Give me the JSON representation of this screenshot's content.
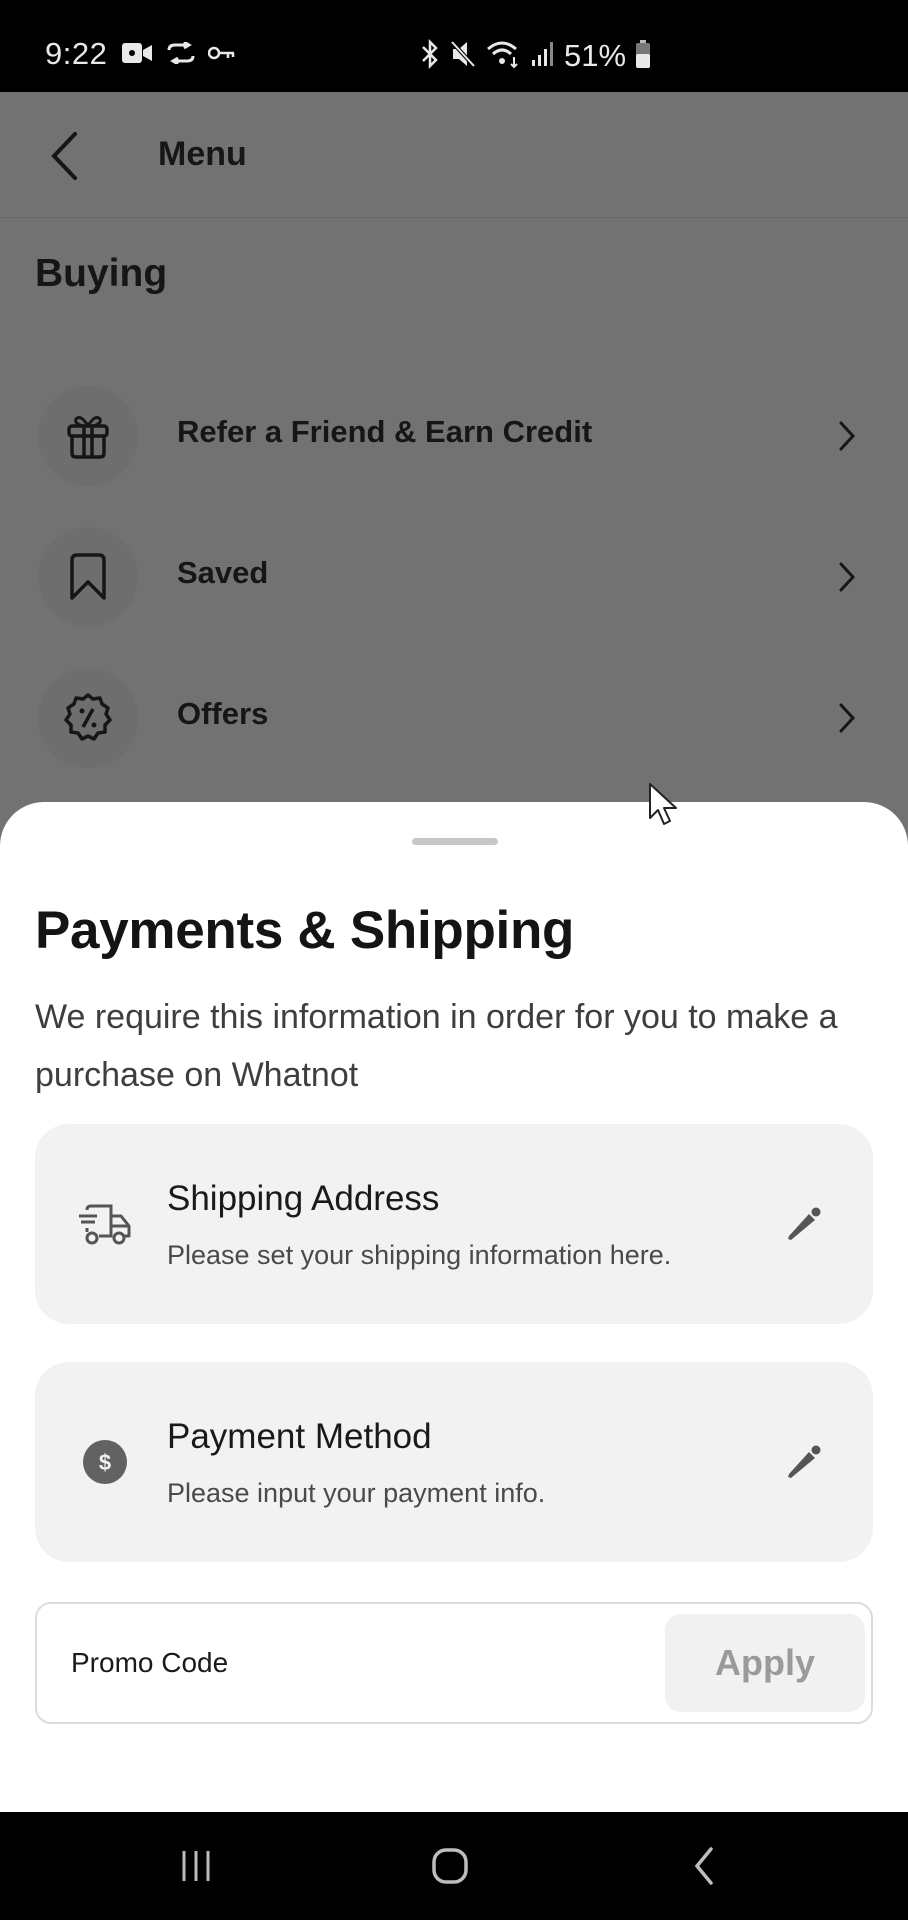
{
  "status_bar": {
    "time": "9:22",
    "battery_percent": "51%",
    "left_icons": [
      "video-record-icon",
      "sync-cloud-icon",
      "vpn-key-icon"
    ],
    "right_icons": [
      "bluetooth-icon",
      "mute-icon",
      "wifi-icon",
      "signal-icon",
      "battery-icon"
    ]
  },
  "app": {
    "header": {
      "title": "Menu",
      "back_icon": "chevron-left-icon"
    },
    "section_title": "Buying",
    "menu_items": [
      {
        "label": "Refer a Friend & Earn Credit",
        "icon": "gift-icon"
      },
      {
        "label": "Saved",
        "icon": "bookmark-icon"
      },
      {
        "label": "Offers",
        "icon": "discount-badge-icon"
      }
    ]
  },
  "sheet": {
    "title": "Payments & Shipping",
    "description": "We require this information in order for you to make a purchase on Whatnot",
    "cards": [
      {
        "title": "Shipping Address",
        "subtitle": "Please set your shipping information here.",
        "icon": "truck-icon",
        "action_icon": "pencil-icon"
      },
      {
        "title": "Payment Method",
        "subtitle": "Please input your payment info.",
        "icon": "dollar-circle-icon",
        "action_icon": "pencil-icon"
      }
    ],
    "promo": {
      "placeholder": "Promo Code",
      "value": "",
      "apply_label": "Apply"
    }
  },
  "nav_bar": {
    "buttons": [
      "recent-apps-icon",
      "home-icon",
      "back-icon"
    ]
  },
  "colors": {
    "overlay": "#727272",
    "sheet_bg": "#ffffff",
    "card_bg": "#f2f2f2",
    "apply_disabled_text": "#9a9a9a"
  }
}
